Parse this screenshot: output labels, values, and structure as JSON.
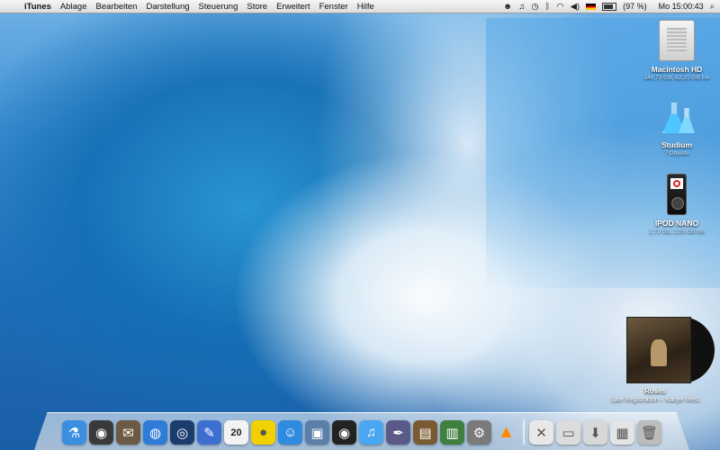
{
  "menubar": {
    "app_name": "iTunes",
    "items": [
      "Ablage",
      "Bearbeiten",
      "Darstellung",
      "Steuerung",
      "Store",
      "Erweitert",
      "Fenster",
      "Hilfe"
    ],
    "battery": "(97 %)",
    "clock": "Mo 15:00:43"
  },
  "desktop": {
    "icons": [
      {
        "label": "Macintosh HD",
        "sub": "148,73 GB, 82,15 GB frei"
      },
      {
        "label": "Studium",
        "sub": "7 Objekte"
      },
      {
        "label": "IPOD NANO",
        "sub": "1,71 GB, 2,55 GB frei"
      }
    ]
  },
  "now_playing": {
    "title": "Roses",
    "artist_album": "Late Registration – Kanye West"
  },
  "dock": {
    "calendar_day": "20",
    "items": [
      {
        "name": "finder-icon",
        "color": "#3b8fe0"
      },
      {
        "name": "dashboard-icon",
        "color": "#3a3a3a"
      },
      {
        "name": "mail-icon",
        "color": "#6d5a44"
      },
      {
        "name": "safari-icon",
        "color": "#2f7bd8"
      },
      {
        "name": "network-globe-icon",
        "color": "#1a3d6e"
      },
      {
        "name": "textedit-icon",
        "color": "#3d6fd1"
      },
      {
        "name": "ical-icon",
        "color": "#f3f3f3"
      },
      {
        "name": "adium-duck-icon",
        "color": "#f2d100"
      },
      {
        "name": "itunes-icon",
        "color": "#2e8be0"
      },
      {
        "name": "iphoto-icon",
        "color": "#5a7fa8"
      },
      {
        "name": "dvd-player-icon",
        "color": "#222222"
      },
      {
        "name": "music-note-icon",
        "color": "#4aa6f0"
      },
      {
        "name": "script-editor-icon",
        "color": "#5a5a88"
      },
      {
        "name": "keynote-icon",
        "color": "#7a5a30"
      },
      {
        "name": "grapher-icon",
        "color": "#3f7f3f"
      },
      {
        "name": "system-preferences-icon",
        "color": "#7a7a7a"
      },
      {
        "name": "vlc-cone-icon",
        "color": "#ff8c00"
      },
      {
        "name": "documents-folder-icon",
        "color": "#e8e8e8"
      },
      {
        "name": "folder-icon",
        "color": "#dcdcdc"
      },
      {
        "name": "downloads-folder-icon",
        "color": "#d8d8d8"
      },
      {
        "name": "photo-folder-icon",
        "color": "#e4e4e4"
      },
      {
        "name": "trash-icon",
        "color": "#bcbcbc"
      }
    ]
  }
}
